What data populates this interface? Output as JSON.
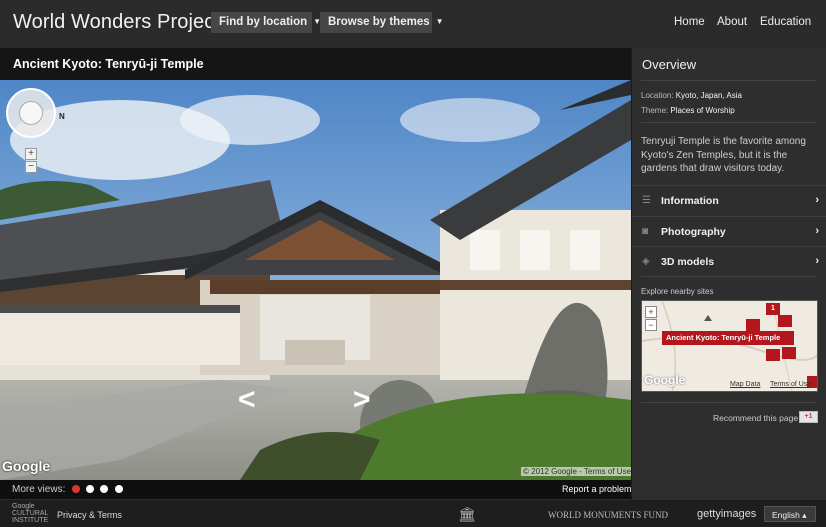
{
  "header": {
    "brand": "World Wonders Project",
    "find_label": "Find by location",
    "browse_label": "Browse by themes",
    "nav": [
      "Home",
      "About",
      "Education"
    ]
  },
  "viewer": {
    "title": "Ancient Kyoto: Tenryū-ji Temple",
    "compass_n": "N",
    "zoom_in": "+",
    "zoom_out": "−",
    "google_mark": "Google",
    "copyright": "© 2012 Google - Terms of Use",
    "more_views": "More views:",
    "report": "Report a problem",
    "dot_colors": [
      "#d9382f",
      "#ffffff",
      "#ffffff",
      "#ffffff"
    ]
  },
  "sidebar": {
    "overview": "Overview",
    "location_label": "Location:",
    "location_value": "Kyoto, Japan, Asia",
    "theme_label": "Theme:",
    "theme_value": "Places of Worship",
    "description": "Tenryuji Temple is the favorite among Kyoto's Zen Temples, but it is the gardens that draw visitors today.",
    "sections": [
      {
        "label": "Information",
        "icon": "list-icon"
      },
      {
        "label": "Photography",
        "icon": "camera-icon"
      },
      {
        "label": "3D models",
        "icon": "cube-icon"
      }
    ],
    "nearby_label": "Explore nearby sites",
    "map_label": "Ancient Kyoto: Tenryū-ji Temple",
    "map_pin_count": "1",
    "map_google": "Google",
    "map_data": "Map Data",
    "map_terms": "Terms of Use",
    "recommend": "Recommend this page",
    "gplus": "+1"
  },
  "footer": {
    "gci": "Google CULTURAL INSTITUTE",
    "privacy": "Privacy & Terms",
    "partners": [
      "WORLD MONUMENTS FUND",
      "gettyimages"
    ],
    "language": "English ▴"
  },
  "colors": {
    "topbar": "#2b2b2b",
    "sidebar": "#2e2e2e",
    "pin_red": "#b3171e",
    "accent_red": "#d9382f"
  }
}
